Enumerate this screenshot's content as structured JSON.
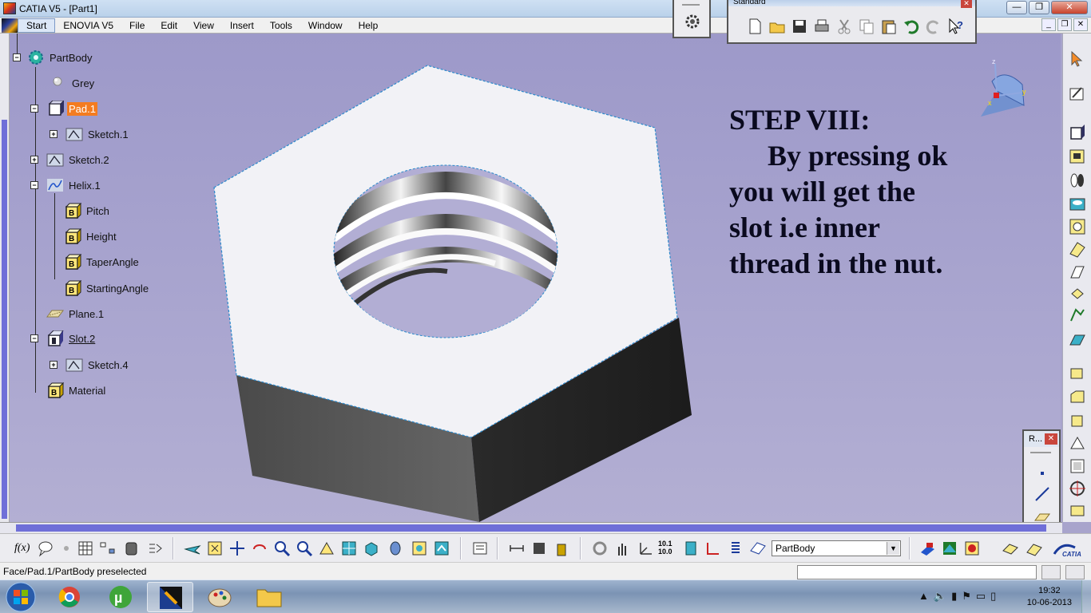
{
  "window": {
    "title": "CATIA V5 - [Part1]",
    "minimize": "—",
    "maximize": "❐",
    "close": "✕"
  },
  "menu": {
    "items": [
      "Start",
      "ENOVIA V5",
      "File",
      "Edit",
      "View",
      "Insert",
      "Tools",
      "Window",
      "Help"
    ]
  },
  "tree": {
    "root_label": "PartBody",
    "nodes": [
      {
        "label": "Grey",
        "icon": "sphere-icon"
      },
      {
        "label": "Pad.1",
        "icon": "pad-icon",
        "highlighted": true
      },
      {
        "label": "Sketch.1",
        "icon": "sketch-icon"
      },
      {
        "label": "Sketch.2",
        "icon": "sketch-icon"
      },
      {
        "label": "Helix.1",
        "icon": "helix-icon"
      },
      {
        "label": "Pitch",
        "icon": "parameter-icon"
      },
      {
        "label": "Height",
        "icon": "parameter-icon"
      },
      {
        "label": "TaperAngle",
        "icon": "parameter-icon"
      },
      {
        "label": "StartingAngle",
        "icon": "parameter-icon"
      },
      {
        "label": "Plane.1",
        "icon": "plane-icon"
      },
      {
        "label": "Slot.2",
        "icon": "slot-icon"
      },
      {
        "label": "Sketch.4",
        "icon": "sketch-icon"
      },
      {
        "label": "Material",
        "icon": "material-icon"
      }
    ]
  },
  "step": {
    "heading": "STEP  VIII:",
    "lines": [
      "By pressing ok",
      "you will get the",
      "slot i.e inner",
      "thread in the nut."
    ]
  },
  "compass": {
    "x": "x",
    "y": "y",
    "z": "z"
  },
  "standard_toolbar": {
    "title": "Standard"
  },
  "r_toolbar": {
    "title": "R...",
    "close": "✕"
  },
  "bottom_toolbar": {
    "part_select": "PartBody",
    "part_arrow": "▼",
    "fx_label": "f(x)"
  },
  "status": {
    "message": "Face/Pad.1/PartBody preselected"
  },
  "taskbar": {
    "time": "19:32",
    "date": "10-06-2013"
  },
  "colors": {
    "viewport_bg": "#a8a4cc",
    "highlight": "#f47c20",
    "nut_top": "#f2f2f6",
    "nut_side_left": "#5e5e5e",
    "nut_side_right": "#262626"
  }
}
